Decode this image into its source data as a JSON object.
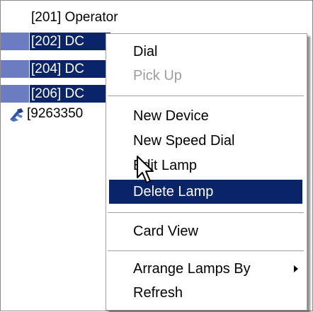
{
  "device_list": {
    "items": [
      {
        "label": "[201] Operator",
        "selected": false
      },
      {
        "label": "[202] DC",
        "selected": true
      },
      {
        "label": "[204] DC",
        "selected": true
      },
      {
        "label": "[206] DC",
        "selected": true
      },
      {
        "label": "[9263350",
        "selected": false,
        "icon": "device-icon"
      }
    ]
  },
  "context_menu": {
    "items": [
      {
        "label": "Dial",
        "enabled": true
      },
      {
        "label": "Pick Up",
        "enabled": false
      },
      {
        "label": "New Device",
        "enabled": true
      },
      {
        "label": "New Speed Dial",
        "enabled": true
      },
      {
        "label": "Edit Lamp",
        "enabled": true
      },
      {
        "label": "Delete Lamp",
        "enabled": true,
        "highlighted": true
      },
      {
        "label": "Card View",
        "enabled": true
      },
      {
        "label": "Arrange Lamps By",
        "enabled": true,
        "submenu": true,
        "icon": "submenu-arrow-icon"
      },
      {
        "label": "Refresh",
        "enabled": true
      }
    ]
  },
  "colors": {
    "selection": "#0a246a",
    "selection_stub": "#6b7cc1",
    "disabled_text": "#9d9d9d"
  },
  "cursor": {
    "icon": "arrow-cursor-icon"
  }
}
